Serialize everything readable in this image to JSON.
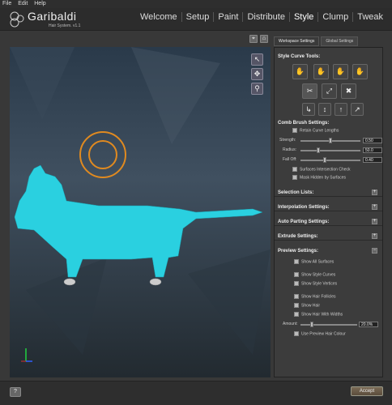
{
  "menu": [
    "File",
    "Edit",
    "Help"
  ],
  "app": {
    "title": "Garibaldi",
    "subtitle": "Hair System.",
    "version": "v1.1"
  },
  "nav": [
    {
      "label": "Welcome",
      "active": false
    },
    {
      "label": "Setup",
      "active": false
    },
    {
      "label": "Paint",
      "active": false
    },
    {
      "label": "Distribute",
      "active": false
    },
    {
      "label": "Style",
      "active": true
    },
    {
      "label": "Clump",
      "active": false
    },
    {
      "label": "Tweak",
      "active": false
    }
  ],
  "tabs": [
    {
      "label": "Workspace Settings",
      "active": true
    },
    {
      "label": "Global Settings",
      "active": false
    }
  ],
  "panel": {
    "style_curve_tools": "Style Curve Tools:",
    "comb_brush_settings": "Comb Brush Settings:",
    "retain_curve_lengths": "Retain Curve Lengths",
    "strength_label": "Strength:",
    "strength_value": "0.50",
    "strength_level": 0.5,
    "radius_label": "Radius:",
    "radius_value": "50.0",
    "radius_level": 0.3,
    "falloff_label": "Fall Off:",
    "falloff_value": "0.40",
    "falloff_level": 0.4,
    "surfaces_intersection": "Surfaces Intersection Check",
    "mask_hidden": "Mask Hidden by Surfaces",
    "selection_lists": "Selection Lists:",
    "interpolation_settings": "Interpolation Settings:",
    "auto_parting": "Auto Parting Settings:",
    "extrude_settings": "Extrude Settings:",
    "preview_settings": "Preview Settings:",
    "show_all_surfaces": "Show All Surfaces",
    "show_style_curves": "Show Style Curves",
    "show_style_vertices": "Show Style Vertices",
    "show_hair_follicles": "Show Hair Follicles",
    "show_hair": "Show Hair",
    "show_hair_widths": "Show Hair With Widths",
    "amount_label": "Amount:",
    "amount_value": "20.0%",
    "amount_level": 0.2,
    "use_preview_colour": "Use Preview Hair Colour"
  },
  "footer": {
    "help": "?",
    "accept": "Accept"
  },
  "colors": {
    "accent": "#8a7a60",
    "hair": "#2ad0e0",
    "brush": "#e08a20"
  }
}
